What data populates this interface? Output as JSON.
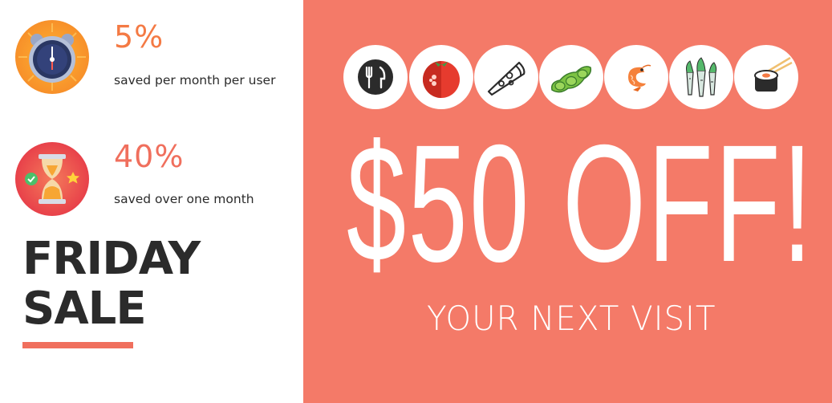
{
  "stats": [
    {
      "value": "5%",
      "caption": "saved per month per user",
      "icon": "alarm-clock-icon",
      "color": "#f47a44"
    },
    {
      "value": "40%",
      "caption": "saved over one month",
      "icon": "hourglass-icon",
      "color": "#f06f5d"
    }
  ],
  "headline": {
    "line1": "FRIDAY",
    "line2": "SALE"
  },
  "food_icons": [
    "fork-knife-icon",
    "tomato-icon",
    "pizza-slice-icon",
    "edamame-icon",
    "shrimp-icon",
    "carrots-icon",
    "sushi-roll-icon"
  ],
  "offer": {
    "amount": "$50 OFF!",
    "subtitle": "YOUR NEXT VISIT"
  },
  "colors": {
    "accent": "#f47a68",
    "text": "#2b2b2b",
    "white": "#ffffff"
  }
}
